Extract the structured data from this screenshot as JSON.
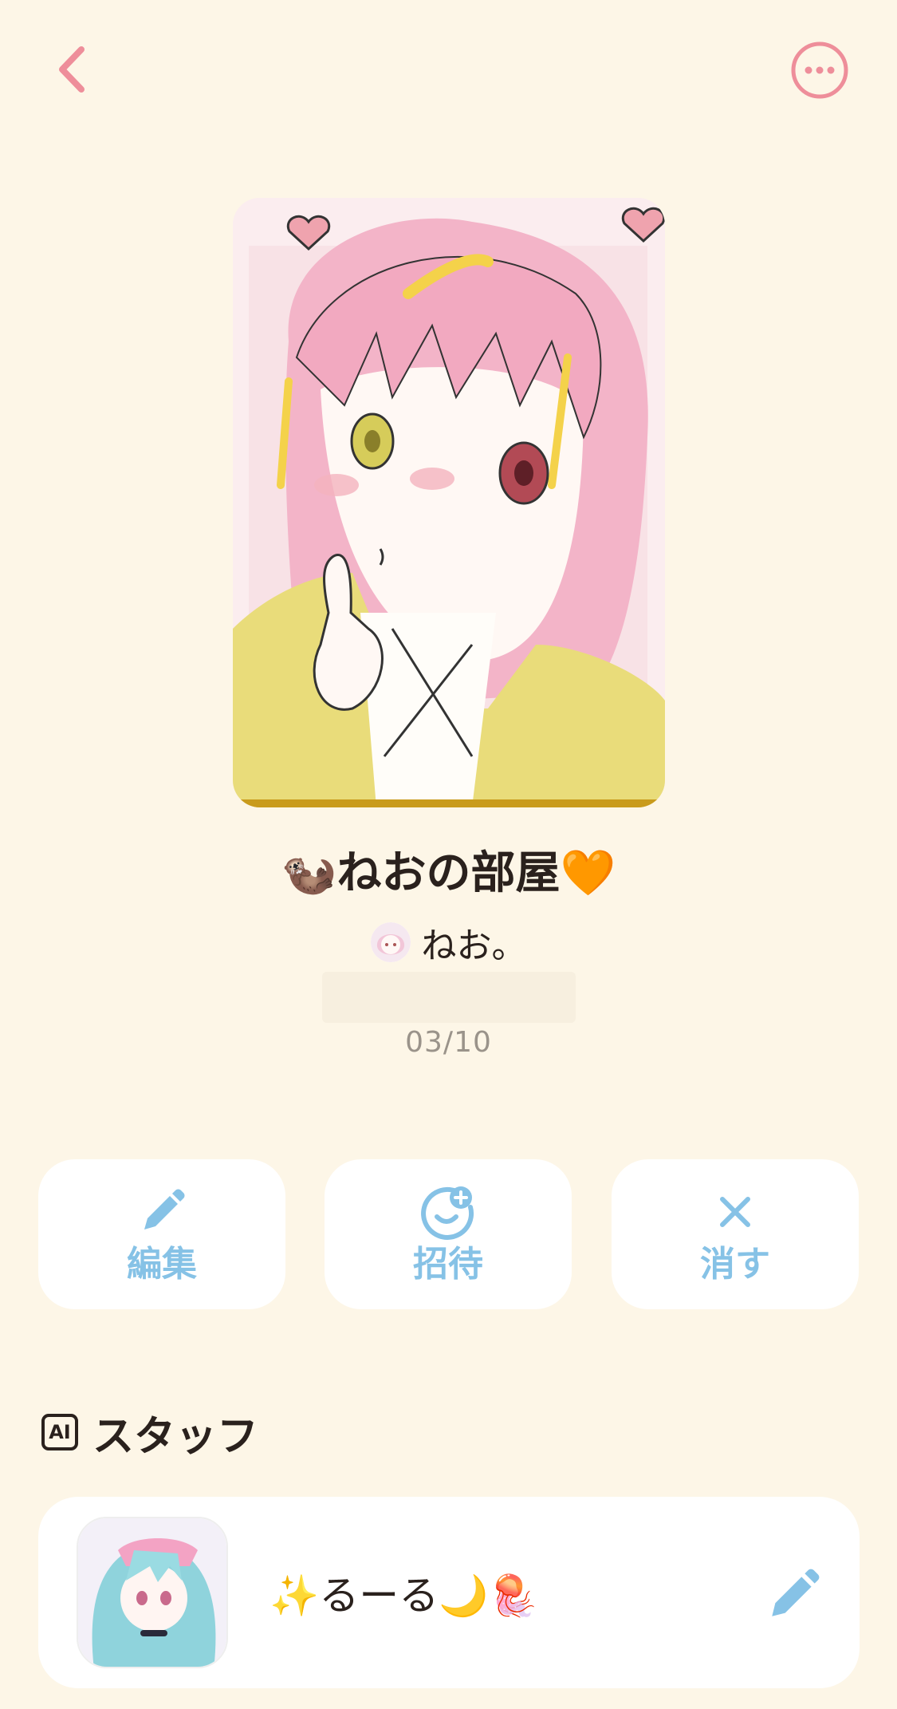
{
  "header": {
    "back_icon": "chevron-left-icon",
    "more_icon": "ellipsis-circle-icon",
    "accent_color": "#EE8E9A"
  },
  "room": {
    "title": "🦦ねおの部屋🧡",
    "owner_name": "ねお。",
    "date": "03/10"
  },
  "actions": {
    "edit_label": "編集",
    "invite_label": "招待",
    "delete_label": "消す",
    "color": "#86C2E6"
  },
  "staff": {
    "ai_badge": "AI",
    "title": "スタッフ",
    "member_name": "✨るーる🌙🪼"
  }
}
